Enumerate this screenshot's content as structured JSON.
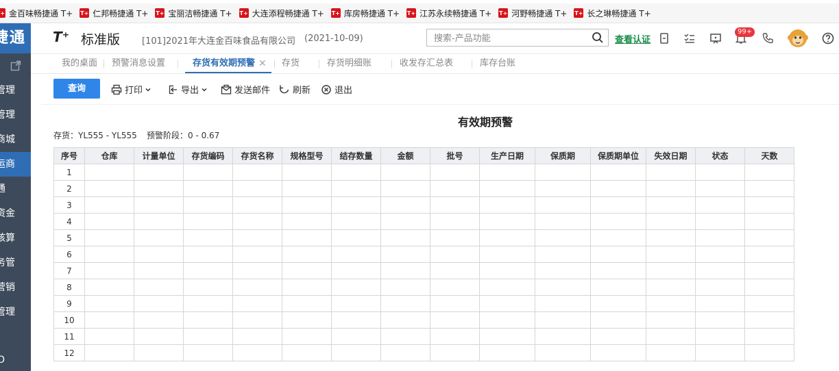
{
  "browser": {
    "bookmarks": [
      {
        "label": "金百味畅捷通 T+",
        "icon": "tplus-icon"
      },
      {
        "label": "仁邦畅捷通 T+",
        "icon": "tplus-icon"
      },
      {
        "label": "宝丽洁畅捷通 T+",
        "icon": "tplus-icon"
      },
      {
        "label": "大连添程畅捷通 T+",
        "icon": "tplus-icon"
      },
      {
        "label": "库房畅捷通 T+",
        "icon": "tplus-icon"
      },
      {
        "label": "江苏永续畅捷通 T+",
        "icon": "tplus-icon"
      },
      {
        "label": "河野畅捷通 T+",
        "icon": "tplus-icon"
      },
      {
        "label": "长之琳畅捷通 T+",
        "icon": "tplus-icon"
      }
    ],
    "bookmark_icon_text": "T+"
  },
  "sidebar": {
    "brand": "捷通",
    "items": [
      {
        "label": "管理",
        "active": false
      },
      {
        "label": "管理",
        "active": false
      },
      {
        "label": "商城",
        "active": false
      },
      {
        "label": "运商",
        "active": true
      },
      {
        "label": "通",
        "active": false
      },
      {
        "label": "资金",
        "active": false
      },
      {
        "label": "核算",
        "active": false
      },
      {
        "label": "务管",
        "active": false
      },
      {
        "label": "营销",
        "active": false
      },
      {
        "label": "管理",
        "active": false
      }
    ],
    "bottom": "O"
  },
  "header": {
    "logo": "T⁺",
    "edition": "标准版",
    "company": "[101]2021年大连金百味食品有限公司",
    "date": "(2021-10-09)",
    "search_placeholder": "搜索-产品功能",
    "verify_link": "查看认证",
    "notification_count": "99+"
  },
  "tabs": [
    {
      "label": "我的桌面",
      "active": false
    },
    {
      "label": "预警消息设置",
      "active": false
    },
    {
      "label": "存货有效期预警",
      "active": true
    },
    {
      "label": "存货",
      "active": false
    },
    {
      "label": "存货明细账",
      "active": false
    },
    {
      "label": "收发存汇总表",
      "active": false
    },
    {
      "label": "库存台账",
      "active": false
    }
  ],
  "toolbar": {
    "query": "查询",
    "print": "打印",
    "export": "导出",
    "email": "发送邮件",
    "refresh": "刷新",
    "exit": "退出"
  },
  "report": {
    "title": "有效期预警",
    "filter_inventory": "存货：YL555 - YL555",
    "filter_stage": "预警阶段：0 - 0.67",
    "columns": [
      "序号",
      "仓库",
      "计量单位",
      "存货编码",
      "存货名称",
      "规格型号",
      "结存数量",
      "金额",
      "批号",
      "生产日期",
      "保质期",
      "保质期单位",
      "失效日期",
      "状态",
      "天数"
    ],
    "rows": [
      "1",
      "2",
      "3",
      "4",
      "5",
      "6",
      "7",
      "8",
      "9",
      "10",
      "11",
      "12"
    ]
  },
  "colors": {
    "sidebar_bg": "#3d4a5b",
    "brand_blue": "#2f6eb5",
    "query_button": "#2f86e8",
    "verify_green": "#1a8c4a",
    "badge_red": "#e8363c"
  }
}
